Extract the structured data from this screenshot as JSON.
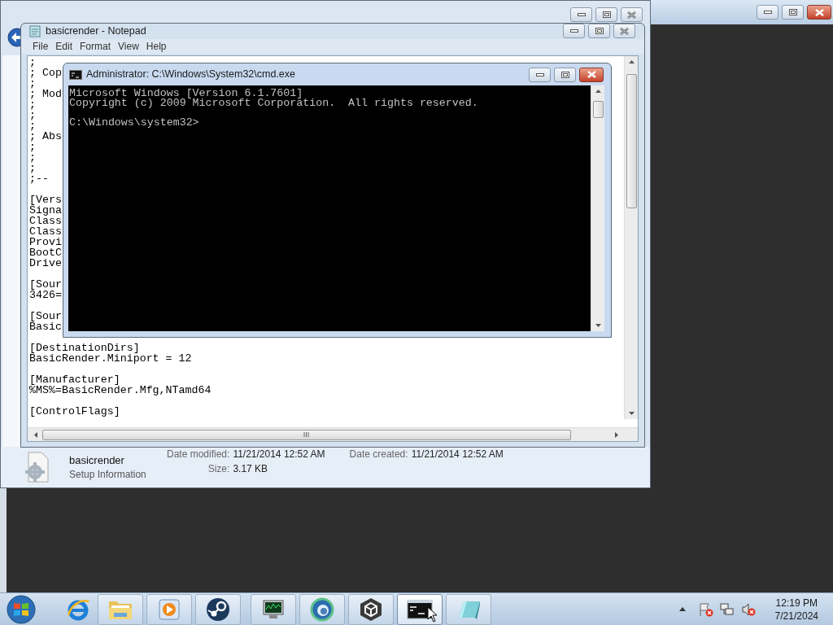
{
  "background_window": {
    "close_hot": true
  },
  "explorer": {
    "close_hot": false,
    "details": {
      "file_name": "basicrender",
      "file_type": "Setup Information",
      "fields": [
        {
          "label": "Date modified:",
          "value": "11/21/2014 12:52 AM"
        },
        {
          "label": "Size:",
          "value": "3.17 KB"
        },
        {
          "label": "Date created:",
          "value": "11/21/2014 12:52 AM"
        }
      ]
    }
  },
  "notepad": {
    "title": "basicrender - Notepad",
    "close_hot": false,
    "menu": [
      "File",
      "Edit",
      "Format",
      "View",
      "Help"
    ],
    "blocks": [
      [
        ";",
        "; Cop",
        ";",
        "; Mod",
        ";",
        ";",
        ";",
        "; Abs",
        ";",
        ";",
        ";",
        ";--"
      ],
      [
        "[Vers",
        "Signa",
        "Class",
        "Class",
        "Provi",
        "BootC",
        "Drive"
      ],
      [
        "[Sour",
        "3426="
      ],
      [
        "[Sour",
        "Basic"
      ],
      [
        "[DestinationDirs]",
        "BasicRender.Miniport = 12"
      ],
      [
        "[Manufacturer]",
        "%MS%=BasicRender.Mfg,NTamd64"
      ],
      [
        "[ControlFlags]"
      ]
    ]
  },
  "cmd": {
    "title": "Administrator: C:\\Windows\\System32\\cmd.exe",
    "close_hot": true,
    "blocks": [
      [
        "Microsoft Windows [Version 6.1.7601]",
        "Copyright (c) 2009 Microsoft Corporation.  All rights reserved."
      ],
      [
        "C:\\Windows\\system32>"
      ]
    ]
  },
  "taskbar": {
    "items": [
      {
        "kind": "browser",
        "running": false,
        "selected": false
      },
      {
        "kind": "folder",
        "running": true,
        "selected": false
      },
      {
        "kind": "media",
        "running": true,
        "selected": false
      },
      {
        "kind": "steam",
        "running": true,
        "selected": false
      },
      {
        "kind": "monitor",
        "running": true,
        "selected": false
      },
      {
        "kind": "orb",
        "running": true,
        "selected": false
      },
      {
        "kind": "cube",
        "running": true,
        "selected": false
      },
      {
        "kind": "terminal",
        "running": true,
        "selected": true
      },
      {
        "kind": "notepad",
        "running": true,
        "selected": false
      }
    ],
    "clock": {
      "time": "12:19 PM",
      "date": "7/21/2024"
    }
  }
}
